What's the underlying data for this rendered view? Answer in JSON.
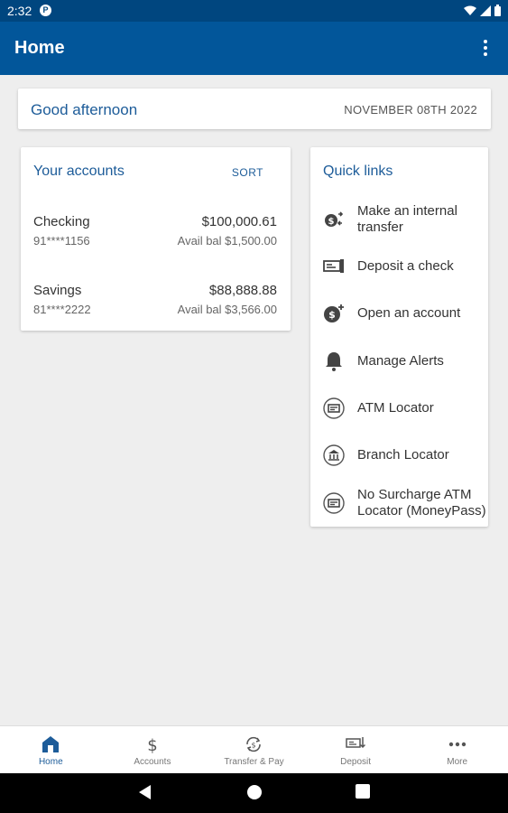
{
  "status_bar": {
    "time": "2:32",
    "notification_glyph": "P"
  },
  "app_bar": {
    "title": "Home"
  },
  "greeting": {
    "text": "Good afternoon",
    "date": "NOVEMBER 08TH 2022"
  },
  "accounts": {
    "heading": "Your accounts",
    "sort_label": "SORT",
    "items": [
      {
        "name": "Checking",
        "number": "91****1156",
        "balance": "$100,000.61",
        "avail": "Avail bal $1,500.00"
      },
      {
        "name": "Savings",
        "number": "81****2222",
        "balance": "$88,888.88",
        "avail": "Avail bal $3,566.00"
      }
    ]
  },
  "quick_links": {
    "heading": "Quick links",
    "items": [
      {
        "label": "Make an internal transfer",
        "icon": "transfer-icon"
      },
      {
        "label": "Deposit a check",
        "icon": "check-icon"
      },
      {
        "label": "Open an account",
        "icon": "open-account-icon"
      },
      {
        "label": "Manage Alerts",
        "icon": "bell-icon"
      },
      {
        "label": "ATM Locator",
        "icon": "atm-icon"
      },
      {
        "label": "Branch Locator",
        "icon": "bank-icon"
      },
      {
        "label": "No Surcharge ATM Locator (MoneyPass)",
        "icon": "atm-icon"
      }
    ]
  },
  "bottom_nav": {
    "items": [
      {
        "label": "Home",
        "icon": "home-icon",
        "active": true
      },
      {
        "label": "Accounts",
        "icon": "dollar-icon",
        "active": false
      },
      {
        "label": "Transfer & Pay",
        "icon": "transfer-pay-icon",
        "active": false
      },
      {
        "label": "Deposit",
        "icon": "deposit-icon",
        "active": false
      },
      {
        "label": "More",
        "icon": "more-icon",
        "active": false
      }
    ]
  },
  "colors": {
    "primary": "#02569a",
    "status_bar": "#00467f",
    "accent_text": "#1d5c99",
    "background": "#eeeeee"
  }
}
